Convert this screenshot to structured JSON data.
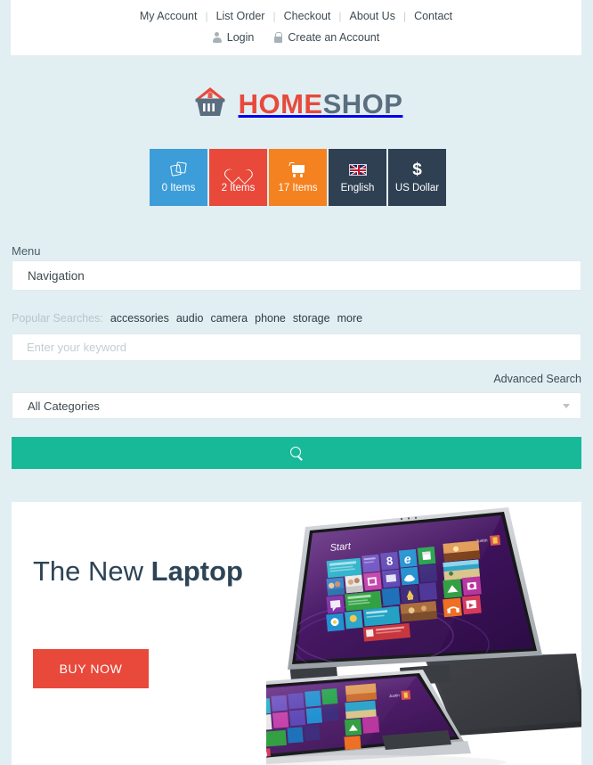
{
  "top_nav": {
    "links": [
      "My Account",
      "List Order",
      "Checkout",
      "About Us",
      "Contact"
    ],
    "separator": "|",
    "login": {
      "label": "Login",
      "icon": "person-icon"
    },
    "create_account": {
      "label": "Create an Account",
      "icon": "lock-icon"
    }
  },
  "logo": {
    "part1": "HOME",
    "part2": "SHOP",
    "icon": "home-basket-icon",
    "color_part1": "#e8493b",
    "color_part2": "#5b6e7f"
  },
  "tiles": [
    {
      "icon": "compare-icon",
      "label": "0 Items",
      "color": "#3c9dd8"
    },
    {
      "icon": "heart-icon",
      "label": "2 Items",
      "color": "#e8493b"
    },
    {
      "icon": "cart-icon",
      "label": "17 Items",
      "color": "#f58220"
    },
    {
      "icon": "uk-flag-icon",
      "label": "English",
      "color": "#2f4052"
    },
    {
      "icon": "dollar-icon",
      "label": "US Dollar",
      "color": "#2f4052"
    }
  ],
  "menu": {
    "label": "Menu",
    "navigation_label": "Navigation"
  },
  "popular_searches": {
    "label": "Popular Searches:",
    "terms": [
      "accessories",
      "audio",
      "camera",
      "phone",
      "storage",
      "more"
    ]
  },
  "search": {
    "placeholder": "Enter your keyword",
    "value": "",
    "advanced_label": "Advanced Search",
    "category_selected": "All Categories",
    "submit_icon": "search-icon",
    "submit_color": "#18b998"
  },
  "hero": {
    "title_light": "The New ",
    "title_bold": "Laptop",
    "buy_label": "BUY NOW",
    "buy_color": "#e8493b",
    "image": "windows8-convertible-laptops",
    "start_label": "Start",
    "user_label": "Justin"
  },
  "theme": {
    "page_background": "#e1eff3",
    "panel_background": "#ffffff",
    "text_color": "#3d4a52"
  }
}
